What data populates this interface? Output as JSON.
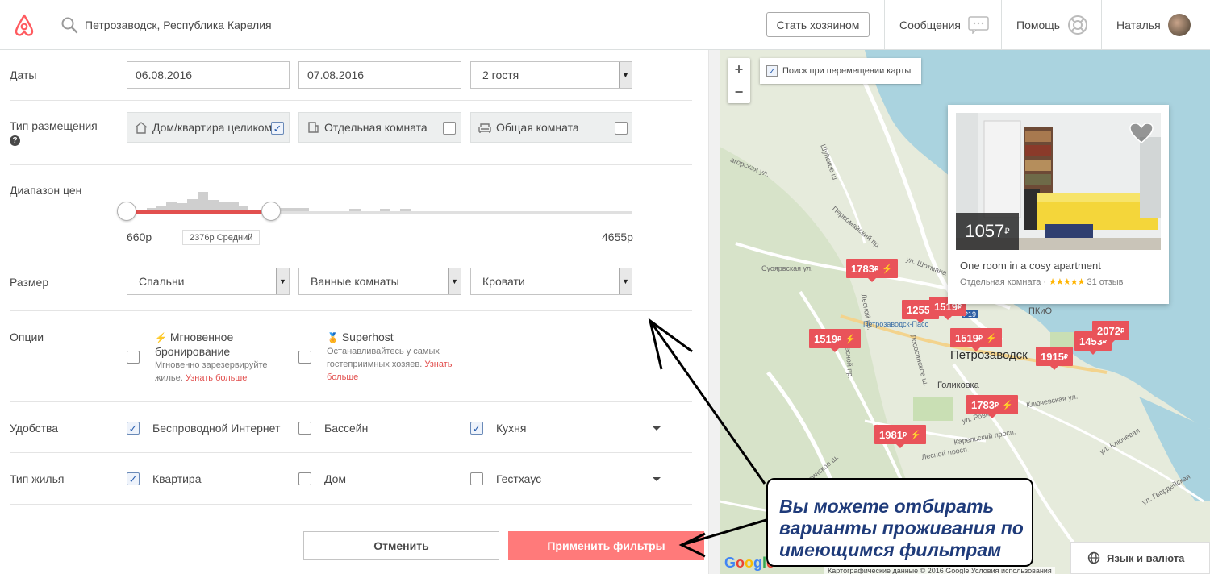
{
  "header": {
    "search_value": "Петрозаводск, Республика Карелия",
    "become_host": "Стать хозяином",
    "messages": "Сообщения",
    "help": "Помощь",
    "user_name": "Наталья"
  },
  "filters": {
    "dates": {
      "label": "Даты",
      "checkin": "06.08.2016",
      "checkout": "07.08.2016",
      "guests": "2 гостя"
    },
    "room_type": {
      "label": "Тип размещения",
      "help": "?",
      "options": [
        {
          "label": "Дом/квартира целиком",
          "checked": true,
          "icon": "home-icon"
        },
        {
          "label": "Отдельная комната",
          "checked": false,
          "icon": "door-icon"
        },
        {
          "label": "Общая комната",
          "checked": false,
          "icon": "sofa-icon"
        }
      ]
    },
    "price_range": {
      "label": "Диапазон цен",
      "min": "660р",
      "max": "4655р",
      "average": "2376р Средний"
    },
    "size": {
      "label": "Размер",
      "bedrooms": "Спальни",
      "bathrooms": "Ванные комнаты",
      "beds": "Кровати"
    },
    "options": {
      "label": "Опции",
      "instant_book_title": "Мгновенное бронирование",
      "instant_book_desc": "Мгновенно зарезервируйте жилье.",
      "instant_book_more": "Узнать больше",
      "superhost_title": "Superhost",
      "superhost_desc": "Останавливайтесь у самых гостеприимных хозяев.",
      "superhost_more": "Узнать больше"
    },
    "amenities": {
      "label": "Удобства",
      "items": [
        {
          "label": "Беспроводной Интернет",
          "checked": true
        },
        {
          "label": "Бассейн",
          "checked": false
        },
        {
          "label": "Кухня",
          "checked": true
        }
      ]
    },
    "property_type": {
      "label": "Тип жилья",
      "items": [
        {
          "label": "Квартира",
          "checked": true
        },
        {
          "label": "Дом",
          "checked": false
        },
        {
          "label": "Гестхаус",
          "checked": false
        }
      ]
    },
    "cancel": "Отменить",
    "apply": "Применить фильтры"
  },
  "map": {
    "zoom_in": "+",
    "zoom_out": "−",
    "search_on_move": "Поиск при перемещении карты",
    "city": "Петрозаводск",
    "pins": [
      "1783",
      "1519",
      "1255",
      "1519",
      "1519",
      "1783",
      "1981",
      "1915",
      "1453",
      "2072"
    ],
    "card": {
      "price": "1057",
      "title": "One room in a cosy apartment",
      "room_type": "Отдельная комната",
      "stars": "★★★★★",
      "reviews": "31 отзыв"
    },
    "streets": [
      "Суоярвская ул.",
      "Шуйское ш.",
      "Первомайский пр.",
      "Лесной пр.",
      "ул. Шотмана",
      "Петрозаводск-Пасс",
      "Голиковка",
      "Ключевская ул.",
      "ул. Ровио",
      "Карельский просп.",
      "Лесной просп.",
      "ул. Ключевая",
      "ул. Гвардейская",
      "ПКиО",
      "P19"
    ],
    "google": "Google",
    "credit": "Картографические данные © 2016 Google    Условия использования"
  },
  "language": "Язык и валюта",
  "callout": {
    "line1": "Вы можете отбирать",
    "line2": "варианты проживания по",
    "line3": "имеющимся фильтрам"
  },
  "colors": {
    "accent": "#ff5a5f",
    "apply_button": "#ff7a7a",
    "pin": "#e9535a",
    "callout_text": "#1f3b7a"
  }
}
